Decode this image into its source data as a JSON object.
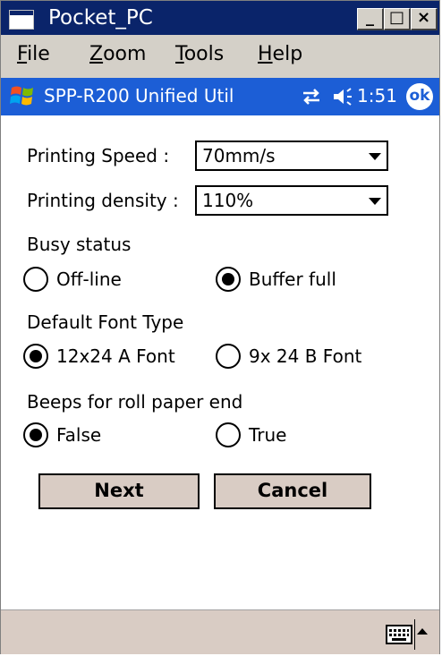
{
  "window": {
    "title": "Pocket_PC",
    "buttons": {
      "minimize": "_",
      "maximize": "□",
      "close": "×"
    }
  },
  "menu": {
    "items": [
      {
        "accel": "F",
        "rest": "ile"
      },
      {
        "accel": "Z",
        "rest": "oom"
      },
      {
        "accel": "T",
        "rest": "ools"
      },
      {
        "accel": "H",
        "rest": "elp"
      }
    ]
  },
  "device_bar": {
    "title": "SPP-R200 Unified Util",
    "time": "1:51",
    "ok": "ok"
  },
  "form": {
    "printing_speed_label": "Printing Speed :",
    "printing_speed_value": "70mm/s",
    "printing_density_label": "Printing density :",
    "printing_density_value": "110%",
    "busy_status": {
      "label": "Busy status",
      "options": [
        "Off-line",
        "Buffer full"
      ],
      "selected": "Buffer full"
    },
    "default_font": {
      "label": "Default Font Type",
      "options": [
        "12x24 A Font",
        "9x 24 B Font"
      ],
      "selected": "12x24 A Font"
    },
    "beeps": {
      "label": "Beeps for roll paper end",
      "options": [
        "False",
        "True"
      ],
      "selected": "False"
    },
    "next_label": "Next",
    "cancel_label": "Cancel"
  },
  "colors": {
    "title_bar": "#0a246a",
    "device_bar": "#1c5ed6",
    "button_face": "#d9ccc4"
  }
}
